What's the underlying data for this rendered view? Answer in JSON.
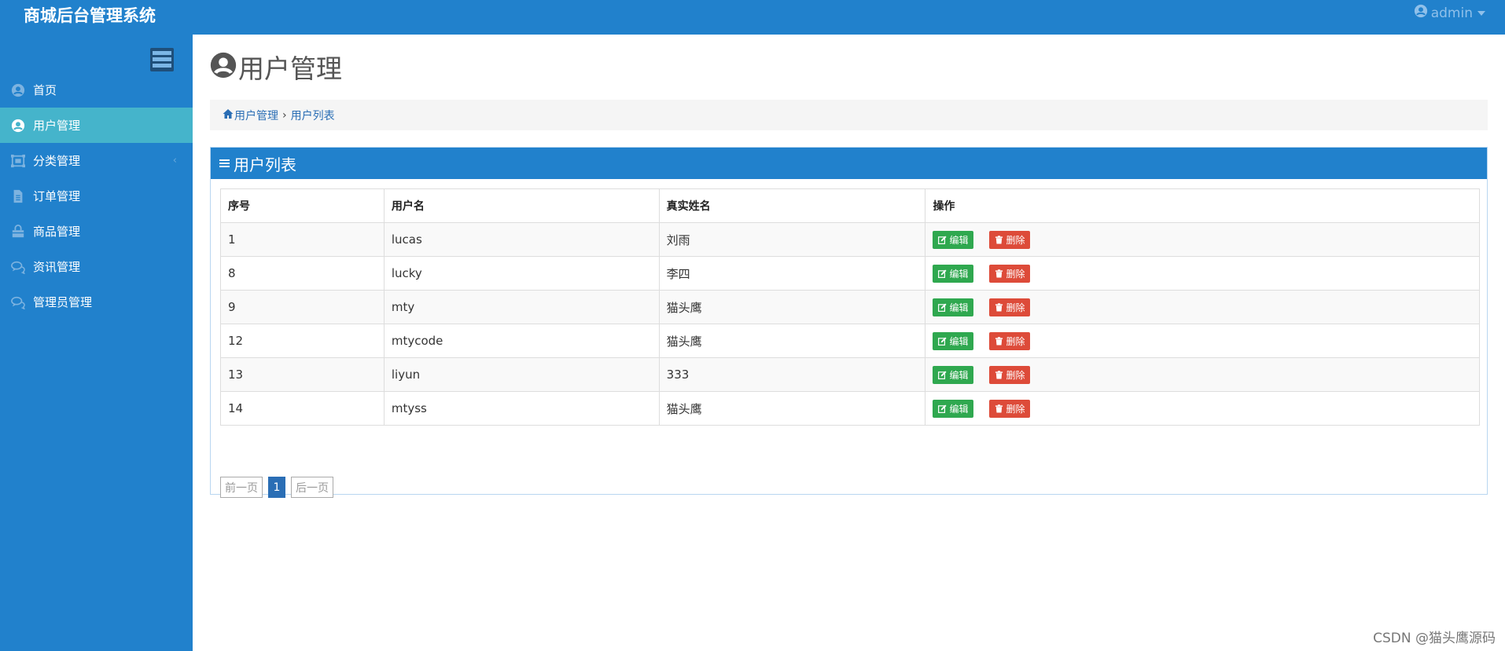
{
  "app": {
    "title": "商城后台管理系统",
    "user": "admin"
  },
  "sidebar": {
    "items": [
      {
        "label": "首页",
        "icon": "user-circle-icon",
        "active": false
      },
      {
        "label": "用户管理",
        "icon": "user-circle-icon",
        "active": true
      },
      {
        "label": "分类管理",
        "icon": "category-icon",
        "active": false
      },
      {
        "label": "订单管理",
        "icon": "document-icon",
        "active": false
      },
      {
        "label": "商品管理",
        "icon": "shopping-bag-icon",
        "active": false
      },
      {
        "label": "资讯管理",
        "icon": "comments-icon",
        "active": false
      },
      {
        "label": "管理员管理",
        "icon": "comments-icon",
        "active": false
      }
    ],
    "submenu_arrow": "‹"
  },
  "page": {
    "title": "用户管理",
    "breadcrumb": {
      "home": "用户管理",
      "separator": "›",
      "current": "用户列表"
    }
  },
  "panel": {
    "title": "用户列表",
    "columns": [
      "序号",
      "用户名",
      "真实姓名",
      "操作"
    ],
    "rows": [
      {
        "id": "1",
        "username": "lucas",
        "realname": "刘雨"
      },
      {
        "id": "8",
        "username": "lucky",
        "realname": "李四"
      },
      {
        "id": "9",
        "username": "mty",
        "realname": "猫头鹰"
      },
      {
        "id": "12",
        "username": "mtycode",
        "realname": "猫头鹰"
      },
      {
        "id": "13",
        "username": "liyun",
        "realname": "333"
      },
      {
        "id": "14",
        "username": "mtyss",
        "realname": "猫头鹰"
      }
    ],
    "edit_label": "编辑",
    "delete_label": "删除"
  },
  "pagination": {
    "prev": "前一页",
    "current": "1",
    "next": "后一页"
  },
  "watermark": "CSDN @猫头鹰源码",
  "colors": {
    "primary": "#2181cc",
    "active_nav": "#45b4cb",
    "edit": "#2fa84f",
    "delete": "#dd4b39",
    "link": "#2a6eb5"
  }
}
